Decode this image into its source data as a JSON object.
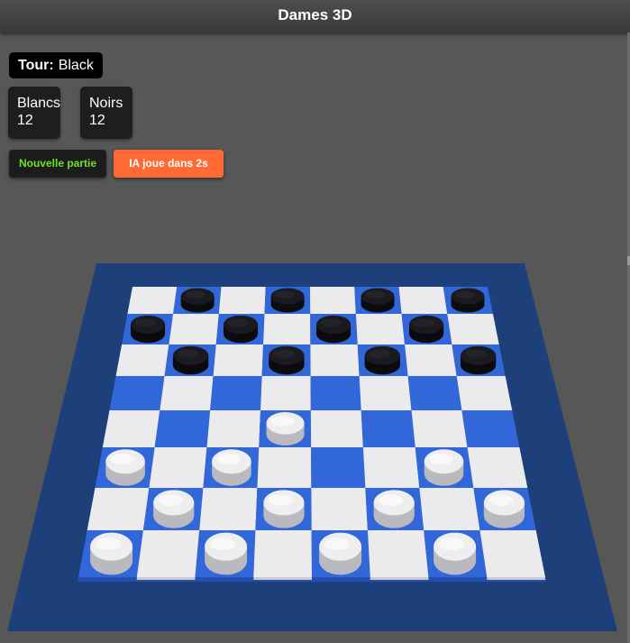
{
  "app": {
    "title": "Dames 3D"
  },
  "status": {
    "turn_label": "Tour:",
    "turn_value": "Black"
  },
  "scores": {
    "white": {
      "label": "Blancs",
      "count": "12"
    },
    "black": {
      "label": "Noirs",
      "count": "12"
    }
  },
  "buttons": {
    "new_game": "Nouvelle partie",
    "ai_timer": "IA joue dans 2s"
  },
  "colors": {
    "board_border": "#1d3f7a",
    "dark_square": "#3167d8",
    "light_square": "#ebebee",
    "black_piece": "#1b1b1f",
    "white_piece": "#eeeeef",
    "new_game_text": "#6fe227",
    "ai_button": "#ff6a34"
  },
  "board": {
    "size": 8,
    "pieces": {
      "black": [
        [
          0,
          1
        ],
        [
          0,
          3
        ],
        [
          0,
          5
        ],
        [
          0,
          7
        ],
        [
          1,
          0
        ],
        [
          1,
          2
        ],
        [
          1,
          4
        ],
        [
          1,
          6
        ],
        [
          2,
          1
        ],
        [
          2,
          3
        ],
        [
          2,
          5
        ],
        [
          2,
          7
        ]
      ],
      "white": [
        [
          4,
          3
        ],
        [
          5,
          0
        ],
        [
          5,
          2
        ],
        [
          5,
          6
        ],
        [
          6,
          1
        ],
        [
          6,
          3
        ],
        [
          6,
          5
        ],
        [
          6,
          7
        ],
        [
          7,
          0
        ],
        [
          7,
          2
        ],
        [
          7,
          4
        ],
        [
          7,
          6
        ]
      ]
    }
  }
}
